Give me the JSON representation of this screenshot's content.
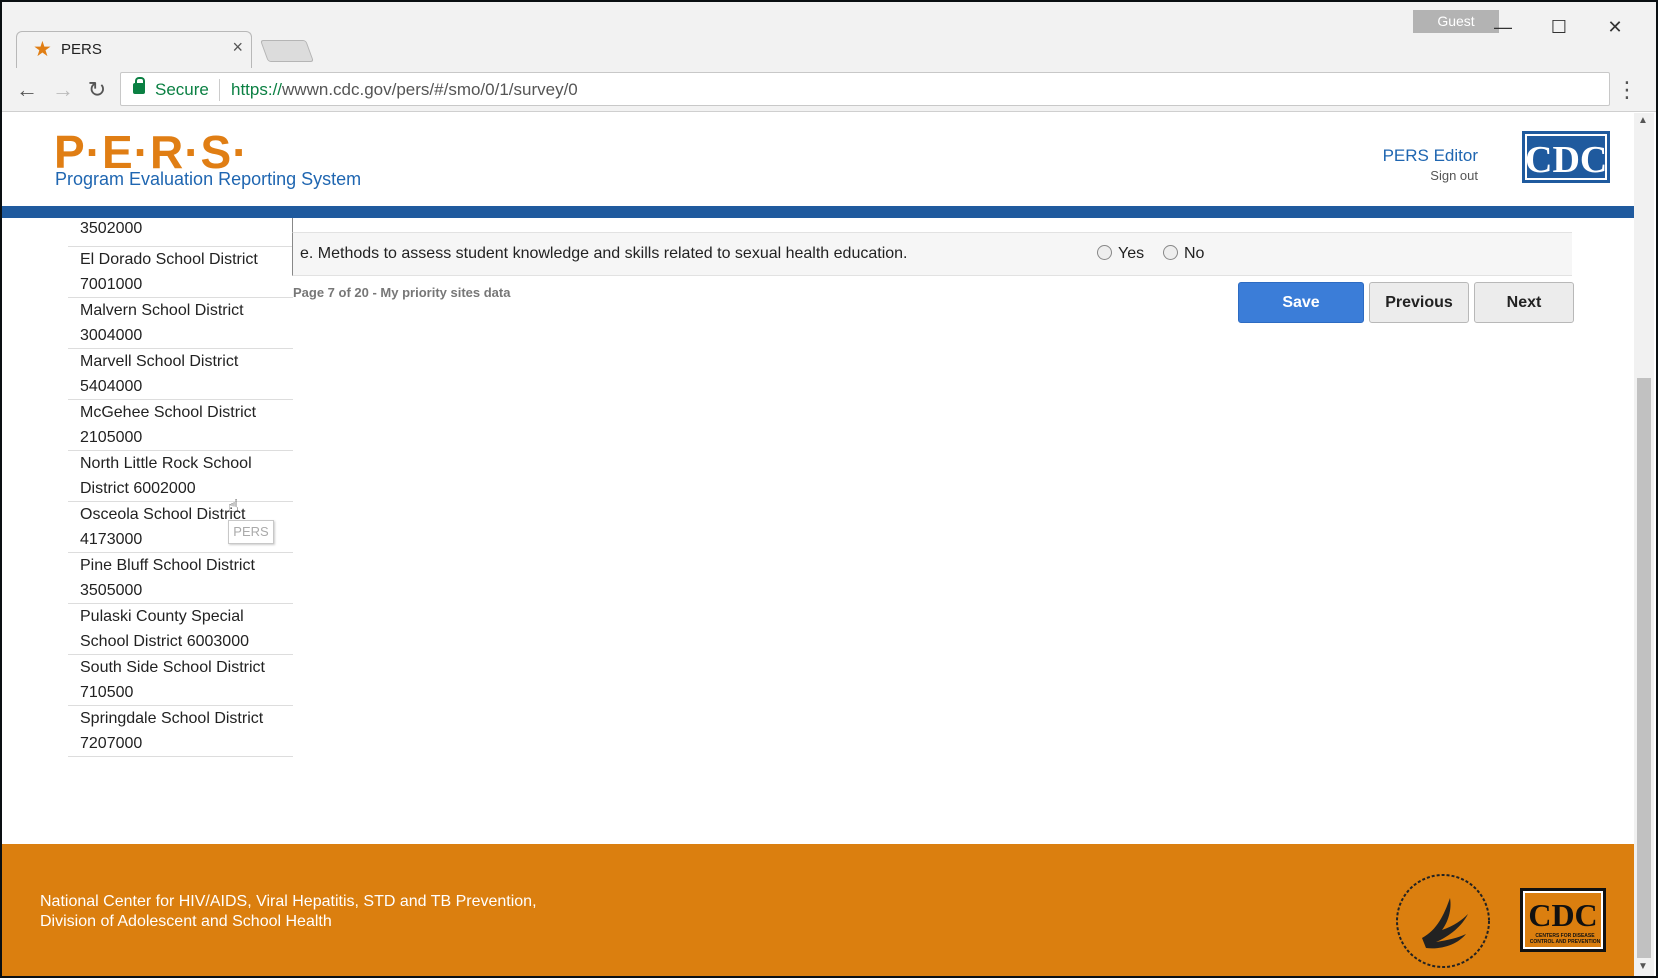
{
  "browser": {
    "tab_title": "PERS",
    "tab_close": "×",
    "profile": "Guest",
    "secure_label": "Secure",
    "url_scheme": "https://",
    "url_rest": "wwwn.cdc.gov/pers/#/smo/0/1/survey/0"
  },
  "header": {
    "logo": "P·E·R·S·",
    "subtitle": "Program Evaluation Reporting System",
    "user_role": "PERS Editor",
    "sign_out": "Sign out",
    "cdc_logo": "CDC"
  },
  "sidebar": {
    "items": [
      {
        "line1": "",
        "line2": "3502000"
      },
      {
        "line1": "El Dorado School District",
        "line2": "7001000"
      },
      {
        "line1": "Malvern School District",
        "line2": "3004000"
      },
      {
        "line1": "Marvell School District",
        "line2": "5404000"
      },
      {
        "line1": "McGehee School District",
        "line2": "2105000"
      },
      {
        "line1": "North Little Rock School",
        "line2": "District 6002000"
      },
      {
        "line1": "Osceola School District",
        "line2": "4173000"
      },
      {
        "line1": "Pine Bluff School District",
        "line2": "3505000"
      },
      {
        "line1": "Pulaski County Special",
        "line2": "School District 6003000"
      },
      {
        "line1": "South Side School District",
        "line2": "710500"
      },
      {
        "line1": "Springdale School District",
        "line2": "7207000"
      }
    ]
  },
  "question": {
    "text": "e. Methods to assess student knowledge and skills related to sexual health education.",
    "option_yes": "Yes",
    "option_no": "No"
  },
  "pager": {
    "info": "Page 7 of 20 - My priority sites data",
    "save": "Save",
    "previous": "Previous",
    "next": "Next"
  },
  "tooltip": "PERS",
  "footer": {
    "line1": "National Center for HIV/AIDS, Viral Hepatitis, STD and TB Prevention,",
    "line2": "Division of Adolescent and School Health",
    "cdc_logo": "CDC",
    "cdc_tagline": "CENTERS FOR DISEASE CONTROL AND PREVENTION"
  }
}
